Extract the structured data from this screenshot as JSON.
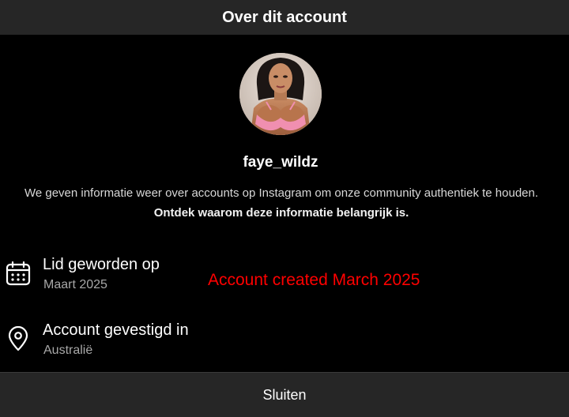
{
  "header": {
    "title": "Over dit account"
  },
  "profile": {
    "username": "faye_wildz",
    "avatar": "profile-photo"
  },
  "info": {
    "text": "We geven informatie weer over accounts op Instagram om onze community authentiek te houden. ",
    "link": "Ontdek waarom deze informatie belangrijk is."
  },
  "details": {
    "joined": {
      "icon": "calendar-icon",
      "title": "Lid geworden op",
      "value": "Maart 2025"
    },
    "location": {
      "icon": "location-pin-icon",
      "title": "Account gevestigd in",
      "value": "Australië"
    }
  },
  "annotation": {
    "text": "Account created March 2025",
    "color": "#ff0000"
  },
  "footer": {
    "close_label": "Sluiten"
  }
}
